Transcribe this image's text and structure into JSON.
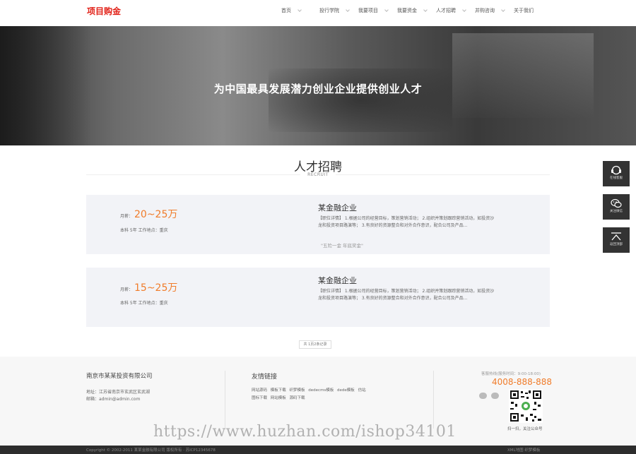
{
  "header": {
    "logo": "项目购金",
    "nav": [
      "首页",
      "投行学院",
      "我要项目",
      "我要资金",
      "人才招聘",
      "并购咨询",
      "关于我们"
    ]
  },
  "banner": {
    "title": "为中国最具发展潜力创业企业提供创业人才"
  },
  "section": {
    "title": "人才招聘",
    "subtitle": "RECRUIT"
  },
  "jobs": [
    {
      "salary_label": "月薪：",
      "salary": "20~25万",
      "meta": "本科 5年 工作地点：重庆",
      "company": "某金融企业",
      "desc": "【职位详情】 1.根据公司的经营目标，策划营销活动； 2.组织并策划跟踪营销活动，如投资沙龙和投资项目路演等； 3.有良好的资源整合和对外合作意识，配合公司及产品...",
      "welfare": "\"五险一金 年底奖金\""
    },
    {
      "salary_label": "月薪：",
      "salary": "15~25万",
      "meta": "本科 5年 工作地点：重庆",
      "company": "某金融企业",
      "desc": "【职位详情】 1.根据公司的经营目标，策划营销活动； 2.组织并策划跟踪营销活动，如投资沙龙和投资项目路演等； 3.有良好的资源整合和对外合作意识，配合公司及产品...",
      "welfare": ""
    }
  ],
  "pager": "共 1页2条记录",
  "footer": {
    "company": "南京市某某投资有限公司",
    "address": "地址：江苏省南京市玄武区玄武湖",
    "email": "邮箱：admin@admin.com",
    "links_title": "友情链接",
    "links": [
      "网站源码",
      "模板下载",
      "织梦模板",
      "dedecms模板",
      "dede模板",
      "仿站",
      "图标下载",
      "网站模板",
      "源码下载"
    ],
    "hours": "客服热线(服务时间：9:00-18:00)",
    "phone": "4008-888-888",
    "qr_label": "扫一扫，关注公众号"
  },
  "watermark": "https://www.huzhan.com/ishop34101",
  "bottom": {
    "copyright": "Copyright © 2002-2011 某某金融有限公司 版权所有 · 苏ICP12345678",
    "links": "XML地图   织梦模板"
  },
  "side": [
    {
      "label": "在线客服",
      "icon": "headset-icon"
    },
    {
      "label": "关注微信",
      "icon": "wechat-icon"
    },
    {
      "label": "返回顶部",
      "icon": "back-to-top-icon"
    }
  ],
  "colors": {
    "accent": "#f07c2a",
    "logo": "#e2231a",
    "side": "#333333"
  }
}
